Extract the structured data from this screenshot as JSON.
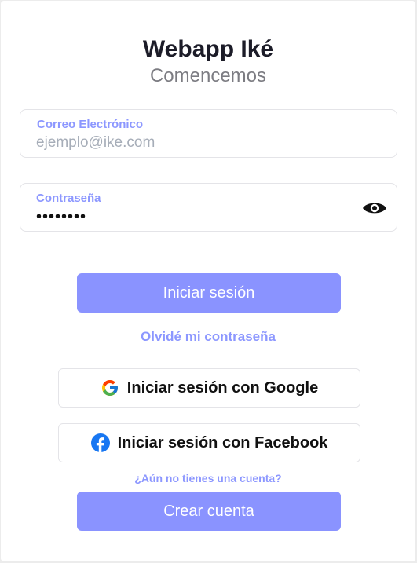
{
  "app": {
    "title": "Webapp Iké",
    "subtitle": "Comencemos"
  },
  "form": {
    "email": {
      "label": "Correo Electrónico",
      "placeholder": "ejemplo@ike.com",
      "value": ""
    },
    "password": {
      "label": "Contraseña",
      "value": "password",
      "visibility_icon": "eye-icon"
    }
  },
  "actions": {
    "login_label": "Iniciar sesión",
    "forgot_password_label": "Olvidé mi contraseña",
    "google_label": "Iniciar sesión con Google",
    "google_icon": "google-icon",
    "facebook_label": "Iniciar sesión con Facebook",
    "facebook_icon": "facebook-icon",
    "no_account_label": "¿Aún no tienes una cuenta?",
    "create_account_label": "Crear cuenta"
  },
  "colors": {
    "accent": "#8a93ff",
    "label": "#8c97ff",
    "facebook": "#1877f2"
  }
}
